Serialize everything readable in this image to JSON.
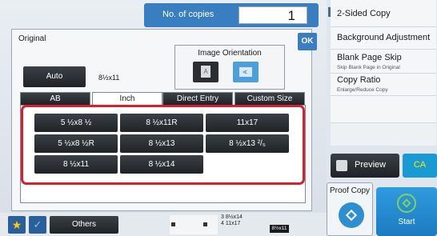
{
  "copies": {
    "label": "No. of copies",
    "value": "1"
  },
  "dialog": {
    "title": "Original",
    "ok_label": "OK",
    "auto_label": "Auto",
    "auto_size": "8½x11",
    "orientation": {
      "label": "Image Orientation",
      "portrait_glyph": "A",
      "landscape_glyph": "A",
      "selected": "landscape"
    },
    "tabs": [
      {
        "label": "AB",
        "active": false
      },
      {
        "label": "Inch",
        "active": true
      },
      {
        "label": "Direct Entry",
        "active": false
      },
      {
        "label": "Custom Size",
        "active": false
      }
    ],
    "sizes": [
      "5 ½x8 ½",
      "8 ½x11R",
      "11x17",
      "5 ½x8 ½R",
      "8 ½x13",
      "8 ½x13 ²/₅",
      "8 ½x11",
      "8 ½x14"
    ]
  },
  "right_panel": {
    "items": [
      {
        "title": "2-Sided Copy",
        "sub": ""
      },
      {
        "title": "Background Adjustment",
        "sub": ""
      },
      {
        "title": "Blank Page Skip",
        "sub": "Skip Blank Page in Original"
      },
      {
        "title": "Copy Ratio",
        "sub": "Enlarge/Reduce Copy"
      }
    ],
    "preview_label": "Preview",
    "ca_label": "CA",
    "proof_label": "Proof Copy",
    "start_label": "Start"
  },
  "bottom_bar": {
    "others_label": "Others",
    "tray_lines": [
      "3  8½x14",
      "4  11x17"
    ],
    "tray_selected": "8½x11"
  },
  "colors": {
    "accent": "#3a7ec2",
    "highlight": "#d71f30",
    "ca_text": "#ffe600",
    "start": "#1c7bc0"
  },
  "icons": [
    "star-icon",
    "check-icon",
    "preview-icon",
    "proof-copy-icon",
    "start-icon",
    "collapse-arrow-icon"
  ]
}
